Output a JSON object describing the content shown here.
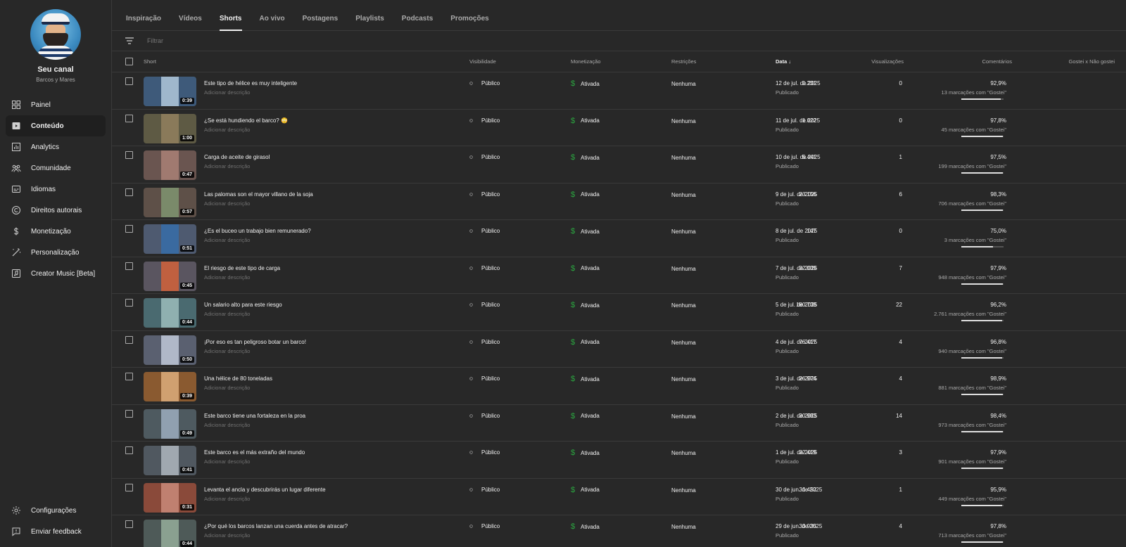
{
  "sidebar": {
    "channel_name": "Seu canal",
    "channel_handle": "Barcos y Mares",
    "items": [
      {
        "label": "Painel",
        "icon": "dashboard-icon"
      },
      {
        "label": "Conteúdo",
        "icon": "content-icon",
        "active": true
      },
      {
        "label": "Analytics",
        "icon": "analytics-icon"
      },
      {
        "label": "Comunidade",
        "icon": "community-icon"
      },
      {
        "label": "Idiomas",
        "icon": "subtitles-icon"
      },
      {
        "label": "Direitos autorais",
        "icon": "copyright-icon"
      },
      {
        "label": "Monetização",
        "icon": "dollar-icon"
      },
      {
        "label": "Personalização",
        "icon": "magic-wand-icon"
      },
      {
        "label": "Creator Music [Beta]",
        "icon": "music-icon"
      }
    ],
    "bottom_items": [
      {
        "label": "Configurações",
        "icon": "gear-icon"
      },
      {
        "label": "Enviar feedback",
        "icon": "feedback-icon"
      }
    ]
  },
  "tabs": [
    "Inspiração",
    "Vídeos",
    "Shorts",
    "Ao vivo",
    "Postagens",
    "Playlists",
    "Podcasts",
    "Promoções"
  ],
  "active_tab": "Shorts",
  "filter": {
    "placeholder": "Filtrar"
  },
  "columns": {
    "short": "Short",
    "visibility": "Visibilidade",
    "monetization": "Monetização",
    "restrictions": "Restrições",
    "date": "Data",
    "views": "Visualizações",
    "comments": "Comentários",
    "likes": "Gostei x Não gostei"
  },
  "rows": [
    {
      "title": "Este tipo de hélice es muy inteligente",
      "desc": "Adicionar descrição",
      "duration": "0:39",
      "visibility": "Público",
      "monetization": "Ativada",
      "restrictions": "Nenhuma",
      "date": "12 de jul. de 2025",
      "status": "Publicado",
      "views": "1.231",
      "comments": "0",
      "likes_pct": "92,9%",
      "likes_count": "13 marcações com \"Gostei\"",
      "ratio": 0.929,
      "thumb_bg": "#3e5a7a",
      "thumb_fg": "#9fb7cc"
    },
    {
      "title": "¿Se está hundiendo el barco? 😳",
      "desc": "Adicionar descrição",
      "duration": "1:00",
      "visibility": "Público",
      "monetization": "Ativada",
      "restrictions": "Nenhuma",
      "date": "11 de jul. de 2025",
      "status": "Publicado",
      "views": "1.622",
      "comments": "0",
      "likes_pct": "97,8%",
      "likes_count": "45 marcações com \"Gostei\"",
      "ratio": 0.978,
      "thumb_bg": "#5e5a44",
      "thumb_fg": "#8a7a5a"
    },
    {
      "title": "Carga de aceite de girasol",
      "desc": "Adicionar descrição",
      "duration": "0:47",
      "visibility": "Público",
      "monetization": "Ativada",
      "restrictions": "Nenhuma",
      "date": "10 de jul. de 2025",
      "status": "Publicado",
      "views": "5.441",
      "comments": "1",
      "likes_pct": "97,5%",
      "likes_count": "199 marcações com \"Gostei\"",
      "ratio": 0.975,
      "thumb_bg": "#6a5550",
      "thumb_fg": "#a07a70"
    },
    {
      "title": "Las palomas son el mayor villano de la soja",
      "desc": "Adicionar descrição",
      "duration": "0:57",
      "visibility": "Público",
      "monetization": "Ativada",
      "restrictions": "Nenhuma",
      "date": "9 de jul. de 2025",
      "status": "Publicado",
      "views": "23.156",
      "comments": "6",
      "likes_pct": "98,3%",
      "likes_count": "706 marcações com \"Gostei\"",
      "ratio": 0.983,
      "thumb_bg": "#5e5048",
      "thumb_fg": "#7a8a6a"
    },
    {
      "title": "¿Es el buceo un trabajo bien remunerado?",
      "desc": "Adicionar descrição",
      "duration": "0:51",
      "visibility": "Público",
      "monetization": "Ativada",
      "restrictions": "Nenhuma",
      "date": "8 de jul. de 2025",
      "status": "Publicado",
      "views": "147",
      "comments": "0",
      "likes_pct": "75,0%",
      "likes_count": "3 marcações com \"Gostei\"",
      "ratio": 0.75,
      "thumb_bg": "#4e5a70",
      "thumb_fg": "#3a6aa0"
    },
    {
      "title": "El riesgo de este tipo de carga",
      "desc": "Adicionar descrição",
      "duration": "0:45",
      "visibility": "Público",
      "monetization": "Ativada",
      "restrictions": "Nenhuma",
      "date": "7 de jul. de 2025",
      "status": "Publicado",
      "views": "32.039",
      "comments": "7",
      "likes_pct": "97,9%",
      "likes_count": "948 marcações com \"Gostei\"",
      "ratio": 0.979,
      "thumb_bg": "#5a5560",
      "thumb_fg": "#c06040"
    },
    {
      "title": "Un salario alto para este riesgo",
      "desc": "Adicionar descrição",
      "duration": "0:44",
      "visibility": "Público",
      "monetization": "Ativada",
      "restrictions": "Nenhuma",
      "date": "5 de jul. de 2025",
      "status": "Publicado",
      "views": "180.738",
      "comments": "22",
      "likes_pct": "96,2%",
      "likes_count": "2.761 marcações com \"Gostei\"",
      "ratio": 0.962,
      "thumb_bg": "#4a6a70",
      "thumb_fg": "#8fb0b0"
    },
    {
      "title": "¡Por eso es tan peligroso botar un barco!",
      "desc": "Adicionar descrição",
      "duration": "0:50",
      "visibility": "Público",
      "monetization": "Ativada",
      "restrictions": "Nenhuma",
      "date": "4 de jul. de 2025",
      "status": "Publicado",
      "views": "76.417",
      "comments": "4",
      "likes_pct": "96,8%",
      "likes_count": "940 marcações com \"Gostei\"",
      "ratio": 0.968,
      "thumb_bg": "#5a6070",
      "thumb_fg": "#b0b8c8"
    },
    {
      "title": "Una hélice de 80 toneladas",
      "desc": "Adicionar descrição",
      "duration": "0:39",
      "visibility": "Público",
      "monetization": "Ativada",
      "restrictions": "Nenhuma",
      "date": "3 de jul. de 2025",
      "status": "Publicado",
      "views": "26.974",
      "comments": "4",
      "likes_pct": "98,9%",
      "likes_count": "881 marcações com \"Gostei\"",
      "ratio": 0.989,
      "thumb_bg": "#8a5a30",
      "thumb_fg": "#d0a070"
    },
    {
      "title": "Este barco tiene una fortaleza en la proa",
      "desc": "Adicionar descrição",
      "duration": "0:49",
      "visibility": "Público",
      "monetization": "Ativada",
      "restrictions": "Nenhuma",
      "date": "2 de jul. de 2025",
      "status": "Publicado",
      "views": "30.983",
      "comments": "14",
      "likes_pct": "98,4%",
      "likes_count": "973 marcações com \"Gostei\"",
      "ratio": 0.984,
      "thumb_bg": "#4e5a60",
      "thumb_fg": "#90a0b0"
    },
    {
      "title": "Este barco es el más extraño del mundo",
      "desc": "Adicionar descrição",
      "duration": "0:41",
      "visibility": "Público",
      "monetization": "Ativada",
      "restrictions": "Nenhuma",
      "date": "1 de jul. de 2025",
      "status": "Publicado",
      "views": "32.419",
      "comments": "3",
      "likes_pct": "97,9%",
      "likes_count": "901 marcações com \"Gostei\"",
      "ratio": 0.979,
      "thumb_bg": "#505860",
      "thumb_fg": "#a0a8b0"
    },
    {
      "title": "Levanta el ancla y descubrirás un lugar diferente",
      "desc": "Adicionar descrição",
      "duration": "0:31",
      "visibility": "Público",
      "monetization": "Ativada",
      "restrictions": "Nenhuma",
      "date": "30 de jun. de 2025",
      "status": "Publicado",
      "views": "31.452",
      "comments": "1",
      "likes_pct": "95,9%",
      "likes_count": "449 marcações com \"Gostei\"",
      "ratio": 0.959,
      "thumb_bg": "#8a4a3a",
      "thumb_fg": "#c08070"
    },
    {
      "title": "¿Por qué los barcos lanzan una cuerda antes de atracar?",
      "desc": "Adicionar descrição",
      "duration": "0:44",
      "visibility": "Público",
      "monetization": "Ativada",
      "restrictions": "Nenhuma",
      "date": "29 de jun. de 2025",
      "status": "Publicado",
      "views": "33.935",
      "comments": "4",
      "likes_pct": "97,8%",
      "likes_count": "713 marcações com \"Gostei\"",
      "ratio": 0.978,
      "thumb_bg": "#4e5a58",
      "thumb_fg": "#8aa090"
    }
  ]
}
